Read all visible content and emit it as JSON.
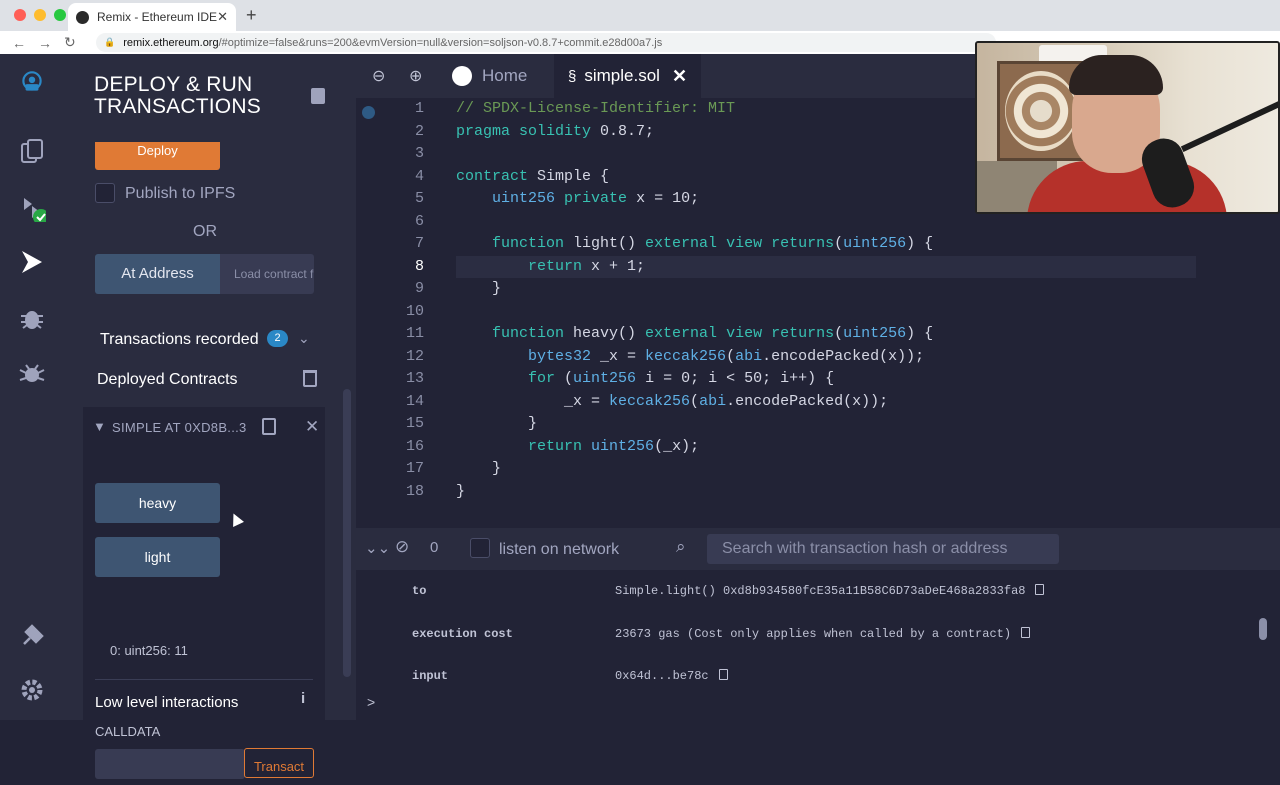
{
  "browser": {
    "tab_title": "Remix - Ethereum IDE",
    "url_host": "remix.ethereum.org",
    "url_path": "/#optimize=false&runs=200&evmVersion=null&version=soljson-v0.8.7+commit.e28d00a7.js"
  },
  "panel": {
    "title_line1": "DEPLOY & RUN",
    "title_line2": "TRANSACTIONS",
    "deploy_label": "Deploy",
    "publish_ipfs": "Publish to IPFS",
    "or": "OR",
    "at_address": "At Address",
    "load_contract_placeholder": "Load contract from Address",
    "transactions_recorded": "Transactions recorded",
    "transactions_count": "2",
    "deployed_contracts": "Deployed Contracts",
    "contract_instance": "SIMPLE AT 0XD8B...3",
    "functions": [
      "heavy",
      "light"
    ],
    "light_result": "0: uint256: 11",
    "low_level": "Low level interactions",
    "calldata": "CALLDATA",
    "transact": "Transact"
  },
  "editor": {
    "tabs": [
      {
        "label": "Home",
        "icon": "remix-logo-icon"
      },
      {
        "label": "simple.sol",
        "icon": "solidity-icon"
      }
    ],
    "active_line": 8,
    "lines": [
      "// SPDX-License-Identifier: MIT",
      "pragma solidity 0.8.7;",
      "",
      "contract Simple {",
      "    uint256 private x = 10;",
      "",
      "    function light() external view returns(uint256) {",
      "        return x + 1;",
      "    }",
      "",
      "    function heavy() external view returns(uint256) {",
      "        bytes32 _x = keccak256(abi.encodePacked(x));",
      "        for (uint256 i = 0; i < 50; i++) {",
      "            _x = keccak256(abi.encodePacked(x));",
      "        }",
      "        return uint256(_x);",
      "    }",
      "}"
    ]
  },
  "terminal": {
    "pending_count": "0",
    "listen_label": "listen on network",
    "search_placeholder": "Search with transaction hash or address",
    "rows": [
      {
        "key": "to",
        "value": "Simple.light() 0xd8b934580fcE35a11B58C6D73aDeE468a2833fa8"
      },
      {
        "key": "execution cost",
        "value": "23673 gas (Cost only applies when called by a contract)"
      },
      {
        "key": "input",
        "value": "0x64d...be78c"
      }
    ],
    "prompt": ">"
  },
  "colors": {
    "accent_orange": "#e07a35",
    "button_blue": "#3e5572",
    "panel_bg": "#2a2c3f",
    "editor_bg": "#222336"
  }
}
